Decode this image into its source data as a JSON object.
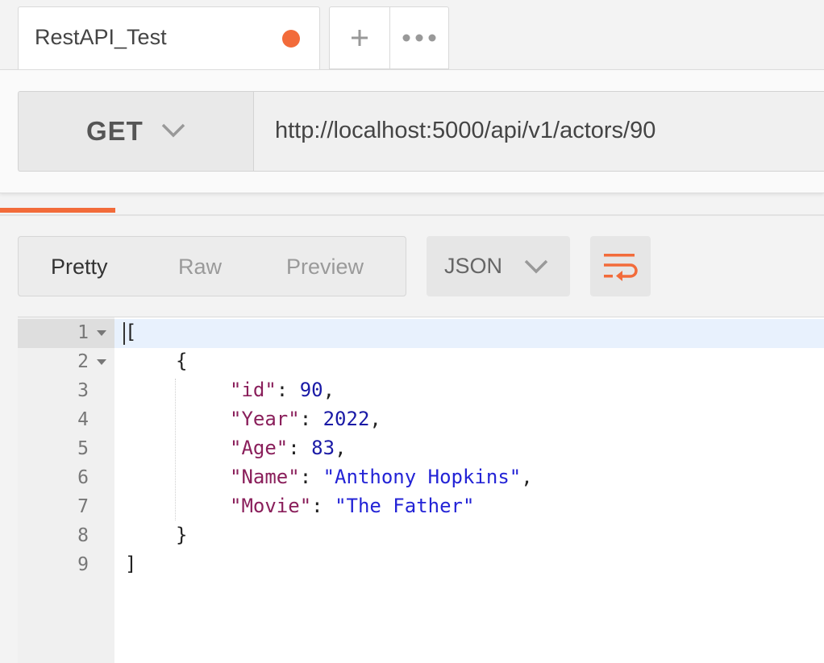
{
  "tab": {
    "title": "RestAPI_Test",
    "unsaved_color": "#f26b3a"
  },
  "tab_actions": {
    "new_tab_icon": "plus-icon",
    "more_icon": "ellipsis-icon"
  },
  "request": {
    "method": "GET",
    "url": "http://localhost:5000/api/v1/actors/90"
  },
  "response_view": {
    "modes": [
      "Pretty",
      "Raw",
      "Preview"
    ],
    "active_mode": "Pretty",
    "format": "JSON",
    "wrap_icon": "wrap-lines-icon"
  },
  "editor": {
    "line_numbers": [
      "1",
      "2",
      "3",
      "4",
      "5",
      "6",
      "7",
      "8",
      "9"
    ],
    "brackets": {
      "open_array": "[",
      "open_object": "{",
      "close_object": "}",
      "close_array": "]"
    },
    "fields": [
      {
        "key": "\"id\"",
        "value": "90",
        "type": "num",
        "trail": ","
      },
      {
        "key": "\"Year\"",
        "value": "2022",
        "type": "num",
        "trail": ","
      },
      {
        "key": "\"Age\"",
        "value": "83",
        "type": "num",
        "trail": ","
      },
      {
        "key": "\"Name\"",
        "value": "\"Anthony Hopkins\"",
        "type": "str",
        "trail": ","
      },
      {
        "key": "\"Movie\"",
        "value": "\"The Father\"",
        "type": "str",
        "trail": ""
      }
    ],
    "colon": ": "
  },
  "colors": {
    "accent": "#f26b3a",
    "json_key": "#8a1f5b",
    "json_number": "#1a1aa6",
    "json_string": "#2323d6"
  }
}
